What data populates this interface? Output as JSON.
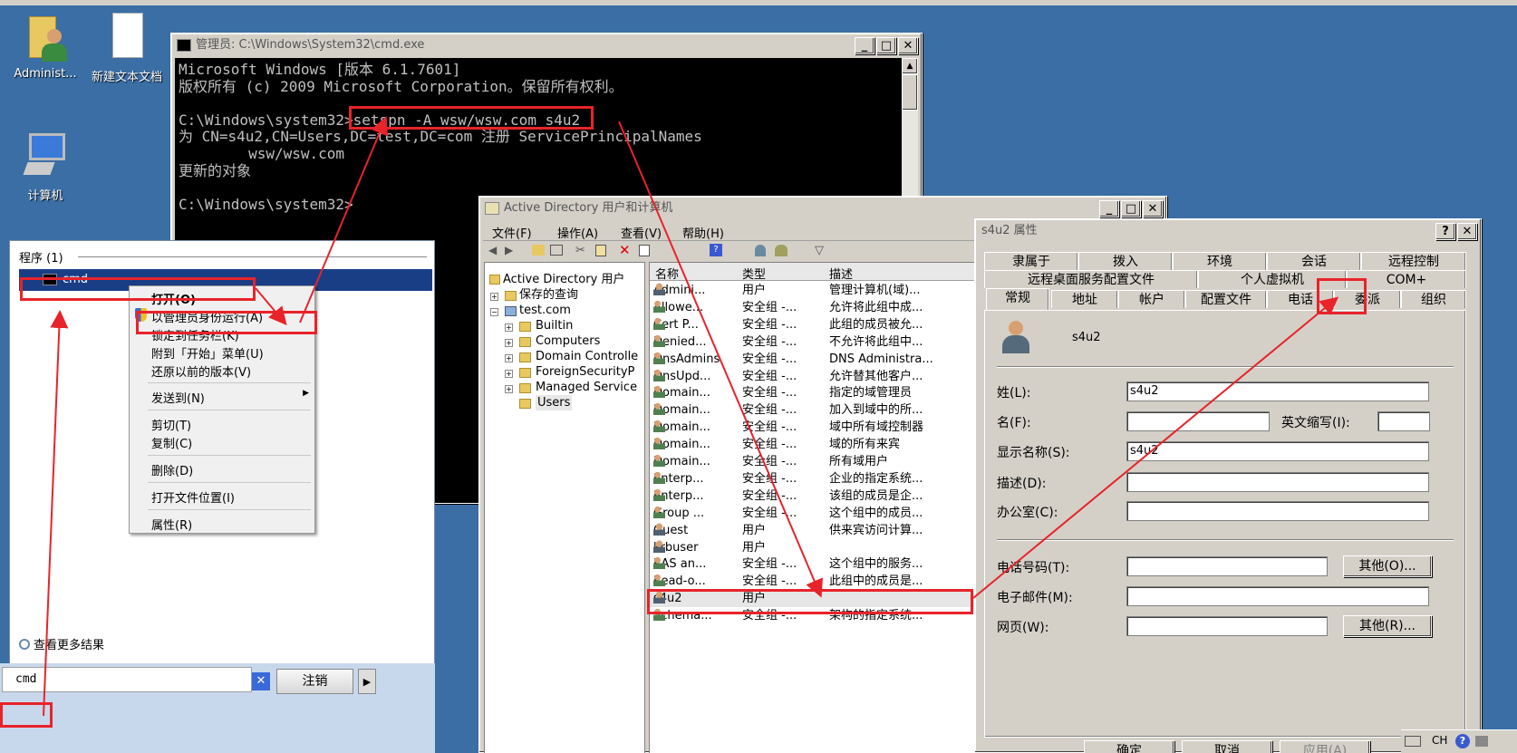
{
  "desktop": {
    "icons": [
      "Administ...",
      "新建文本文档",
      "计算机"
    ]
  },
  "cmd": {
    "title": "管理员: C:\\Windows\\System32\\cmd.exe",
    "lines": [
      "Microsoft Windows [版本 6.1.7601]",
      "版权所有 (c) 2009 Microsoft Corporation。保留所有权利。",
      "",
      "C:\\Windows\\system32>setspn -A wsw/wsw.com s4u2",
      "为 CN=s4u2,CN=Users,DC=test,DC=com 注册 ServicePrincipalNames",
      "        wsw/wsw.com",
      "更新的对象",
      "",
      "C:\\Windows\\system32>"
    ]
  },
  "startmenu": {
    "header": "程序 (1)",
    "item": "cmd",
    "more_results": "查看更多结果",
    "search_value": "cmd",
    "logoff": "注销",
    "logoff_arrow": "▶"
  },
  "context_menu": {
    "items": [
      "打开(O)",
      "以管理员身份运行(A)",
      "锁定到任务栏(K)",
      "附到「开始」菜单(U)",
      "还原以前的版本(V)",
      "发送到(N)",
      "剪切(T)",
      "复制(C)",
      "删除(D)",
      "打开文件位置(I)",
      "属性(R)"
    ]
  },
  "aduc": {
    "title": "Active Directory 用户和计算机",
    "menu": [
      "文件(F)",
      "操作(A)",
      "查看(V)",
      "帮助(H)"
    ],
    "tree": [
      "Active Directory 用户",
      "保存的查询",
      "test.com",
      "Builtin",
      "Computers",
      "Domain Controlle",
      "ForeignSecurityP",
      "Managed Service",
      "Users"
    ],
    "columns": [
      "名称",
      "类型",
      "描述"
    ],
    "rows": [
      [
        "Admini...",
        "用户",
        "管理计算机(域)..."
      ],
      [
        "Allowe...",
        "安全组 -...",
        "允许将此组中成..."
      ],
      [
        "Cert P...",
        "安全组 -...",
        "此组的成员被允..."
      ],
      [
        "Denied...",
        "安全组 -...",
        "不允许将此组中..."
      ],
      [
        "DnsAdmins",
        "安全组 -...",
        "DNS Administra..."
      ],
      [
        "DnsUpd...",
        "安全组 -...",
        "允许替其他客户..."
      ],
      [
        "Domain...",
        "安全组 -...",
        "指定的域管理员"
      ],
      [
        "Domain...",
        "安全组 -...",
        "加入到域中的所..."
      ],
      [
        "Domain...",
        "安全组 -...",
        "域中所有域控制器"
      ],
      [
        "Domain...",
        "安全组 -...",
        "域的所有来宾"
      ],
      [
        "Domain...",
        "安全组 -...",
        "所有域用户"
      ],
      [
        "Enterp...",
        "安全组 -...",
        "企业的指定系统..."
      ],
      [
        "Enterp...",
        "安全组 -...",
        "该组的成员是企..."
      ],
      [
        "Group ...",
        "安全组 -...",
        "这个组中的成员..."
      ],
      [
        "Guest",
        "用户",
        "供来宾访问计算..."
      ],
      [
        "krbuser",
        "用户",
        ""
      ],
      [
        "RAS an...",
        "安全组 -...",
        "这个组中的服务..."
      ],
      [
        "Read-o...",
        "安全组 -...",
        "此组中的成员是..."
      ],
      [
        "s4u2",
        "用户",
        ""
      ],
      [
        "Schema...",
        "安全组 -...",
        "架构的指定系统..."
      ]
    ]
  },
  "props": {
    "title": "s4u2 属性",
    "tabs_row1": [
      "隶属于",
      "拨入",
      "环境",
      "会话",
      "远程控制"
    ],
    "tabs_row2": [
      "远程桌面服务配置文件",
      "个人虚拟机",
      "COM+"
    ],
    "tabs_row3": [
      "常规",
      "地址",
      "帐户",
      "配置文件",
      "电话",
      "委派",
      "组织"
    ],
    "username": "s4u2",
    "fields": {
      "last_name_label": "姓(L):",
      "last_name": "s4u2",
      "first_name_label": "名(F):",
      "first_name": "",
      "initials_label": "英文缩写(I):",
      "initials": "",
      "display_label": "显示名称(S):",
      "display": "s4u2",
      "desc_label": "描述(D):",
      "desc": "",
      "office_label": "办公室(C):",
      "office": "",
      "phone_label": "电话号码(T):",
      "phone": "",
      "email_label": "电子邮件(M):",
      "email": "",
      "web_label": "网页(W):",
      "web": ""
    },
    "other_phone": "其他(O)...",
    "other_web": "其他(R)...",
    "buttons": [
      "确定",
      "取消",
      "应用(A)"
    ]
  },
  "taskbar": {
    "lang": "CH"
  },
  "colors": {
    "annotation": "#e8232a",
    "desktop": "#3a6ea5",
    "selection": "#1a3e86"
  }
}
